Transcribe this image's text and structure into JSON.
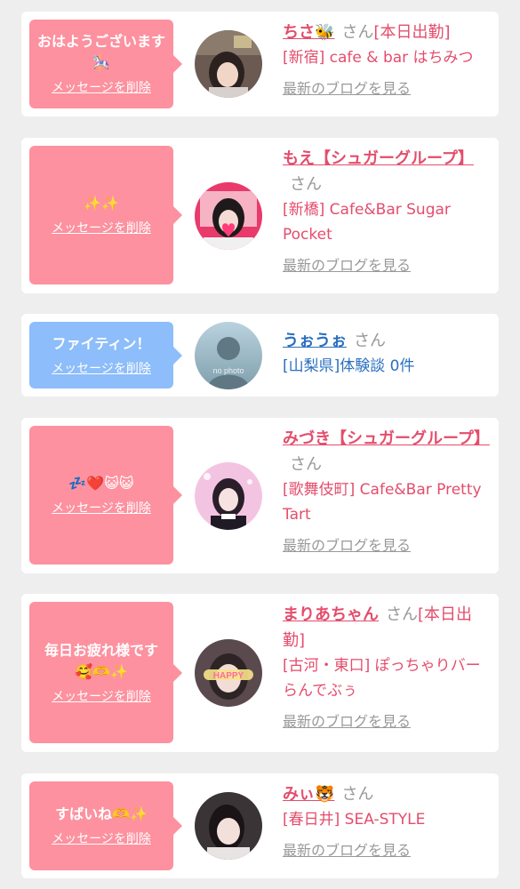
{
  "cards": [
    {
      "message": "おはようございます🎠",
      "delete_label": "メッセージを削除",
      "name": "ちさ🐝",
      "honorific": "さん",
      "status": "[本日出勤]",
      "shop": "[新宿] cafe & bar はちみつ",
      "blog_label": "最新のブログを見る"
    },
    {
      "message": "✨✨",
      "delete_label": "メッセージを削除",
      "name": "もえ【シュガーグループ】",
      "honorific": "さん",
      "status": "",
      "shop": "[新橋] Cafe&Bar Sugar Pocket",
      "blog_label": "最新のブログを見る"
    },
    {
      "message": "ファイティン！",
      "delete_label": "メッセージを削除",
      "name": "うぉうぉ",
      "honorific": "さん",
      "status": "",
      "shop": "[山梨県]体験談 0件",
      "blog_label": "",
      "avatar_text": "no photo"
    },
    {
      "message": "💤❤️😺😺",
      "delete_label": "メッセージを削除",
      "name": "みづき【シュガーグループ】",
      "honorific": "さん",
      "status": "",
      "shop": "[歌舞伎町] Cafe&Bar Pretty Tart",
      "blog_label": "最新のブログを見る"
    },
    {
      "message": "毎日お疲れ様です🥰🫶✨",
      "delete_label": "メッセージを削除",
      "name": "まりあちゃん",
      "honorific": "さん",
      "status": "[本日出勤]",
      "shop": "[古河・東口] ぽっちゃりバー らんでぶぅ",
      "blog_label": "最新のブログを見る",
      "avatar_text": "HAPPY"
    },
    {
      "message": "すばいね🫶✨",
      "delete_label": "メッセージを削除",
      "name": "みぃ🐯",
      "honorific": "さん",
      "status": "",
      "shop": "[春日井] SEA-STYLE",
      "blog_label": "最新のブログを見る"
    }
  ],
  "colors": {
    "bubble_pink": "#fd919f",
    "bubble_blue": "#8dbdfa",
    "name_pink": "#e44d6c",
    "name_blue": "#2a6fbf",
    "muted": "#999999",
    "background": "#eeeeee"
  }
}
